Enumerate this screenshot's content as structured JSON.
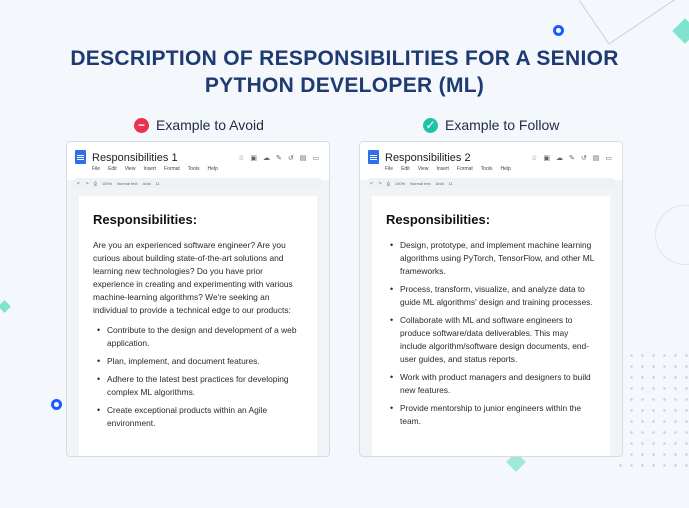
{
  "page": {
    "title_line1": "DESCRIPTION OF RESPONSIBILITIES FOR A SENIOR",
    "title_line2": "PYTHON DEVELOPER (ML)"
  },
  "colors": {
    "title": "#1d3a72",
    "avoid": "#e8344e",
    "follow": "#22c3a5",
    "accent": "#1a5cff"
  },
  "avoid": {
    "label": "Example to Avoid",
    "badge_icon": "minus-icon",
    "doc_name": "Responsibilities 1",
    "menu": [
      "File",
      "Edit",
      "View",
      "Insert",
      "Format",
      "Tools",
      "Help"
    ],
    "heading": "Responsibilities:",
    "paragraph": "Are you an experienced software engineer? Are you curious about building state-of-the-art solutions and learning new technologies? Do you have prior experience in creating and experimenting with various machine-learning algorithms? We're seeking an individual to provide a technical edge to our products:",
    "items": [
      "Contribute to the design and development of a web application.",
      "Plan, implement, and document features.",
      "Adhere to the latest best practices for developing complex ML algorithms.",
      "Create exceptional products within an Agile environment."
    ]
  },
  "follow": {
    "label": "Example to Follow",
    "badge_icon": "check-icon",
    "doc_name": "Responsibilities 2",
    "menu": [
      "File",
      "Edit",
      "View",
      "Insert",
      "Format",
      "Tools",
      "Help"
    ],
    "heading": "Responsibilities:",
    "items": [
      "Design, prototype, and implement machine learning algorithms using PyTorch, TensorFlow, and other ML frameworks.",
      "Process, transform, visualize, and analyze data to guide ML algorithms' design and training processes.",
      "Collaborate with ML and software engineers to produce software/data deliverables. This may include algorithm/software design documents, end-user guides, and status reports.",
      "Work with product managers and designers to build new features.",
      "Provide mentorship to junior engineers within the team."
    ]
  },
  "toolbar": {
    "zoom": "100%",
    "style": "Normal text",
    "font": "Arial",
    "size": "11"
  }
}
